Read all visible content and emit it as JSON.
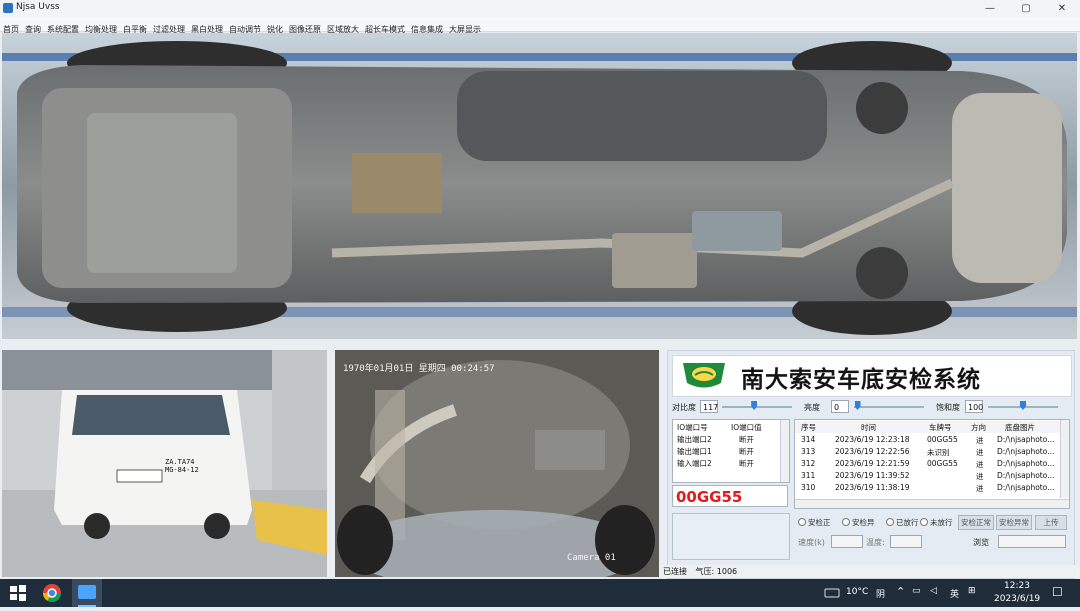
{
  "window": {
    "title": "Njsa Uvss",
    "controls": [
      "—",
      "▢",
      "✕"
    ]
  },
  "menu": [
    "首页",
    "查询",
    "系统配置",
    "均衡处理",
    "白平衡",
    "过滤处理",
    "黑白处理",
    "自动调节",
    "锐化",
    "图像还原",
    "区域放大",
    "超长车模式",
    "信息集成",
    "大屏显示"
  ],
  "camera2": {
    "timestamp": "1970年01月01日 星期四 00:24:57",
    "label": "Camera 01"
  },
  "vehicle_plate_image": "ZA.TA74\nMG-84-12",
  "right_panel": {
    "banner_title": "南大索安车底安检系统",
    "contrast": {
      "label": "对比度",
      "value": "117",
      "level": 0.46
    },
    "brightness": {
      "label": "亮度",
      "value": "0",
      "level": 0.05
    },
    "saturation": {
      "label": "饱和度",
      "value": "100",
      "level": 0.5
    },
    "io_table": {
      "headers": [
        "IO端口号",
        "IO端口值"
      ],
      "rows": [
        [
          "输出端口2",
          "断开"
        ],
        [
          "输出端口1",
          "断开"
        ],
        [
          "输入端口2",
          "断开"
        ]
      ]
    },
    "plate": "00GG55",
    "records": {
      "headers": [
        "序号",
        "时间",
        "车牌号",
        "方向",
        "底盘图片"
      ],
      "rows": [
        [
          "314",
          "2023/6/19 12:23:18",
          "00GG55",
          "进",
          "D:/\\njsaphoto..."
        ],
        [
          "313",
          "2023/6/19 12:22:56",
          "未识别",
          "进",
          "D:/\\njsaphoto..."
        ],
        [
          "312",
          "2023/6/19 12:21:59",
          "00GG55",
          "进",
          "D:/\\njsaphoto..."
        ],
        [
          "311",
          "2023/6/19 11:39:52",
          "",
          "进",
          "D:/\\njsaphoto..."
        ],
        [
          "310",
          "2023/6/19 11:38:19",
          "",
          "进",
          "D:/\\njsaphoto..."
        ]
      ]
    },
    "radios": [
      "安检正",
      "安检异",
      "已放行",
      "未放行"
    ],
    "buttons": [
      "安检正常",
      "安检异常",
      "上传"
    ],
    "row2": {
      "label1": "速度(k)",
      "label2": "温度:",
      "button": "浏览"
    }
  },
  "status": {
    "connection": "已连接",
    "pressure": "气压: 1006"
  },
  "taskbar": {
    "weather_temp": "10°C",
    "weather_desc": "阴",
    "ime": "英",
    "time": "12:23",
    "date": "2023/6/19"
  },
  "colors": {
    "plate_red": "#e01b1b",
    "slider_blue": "#2f7fe0",
    "taskbar": "#1f2c3a"
  }
}
